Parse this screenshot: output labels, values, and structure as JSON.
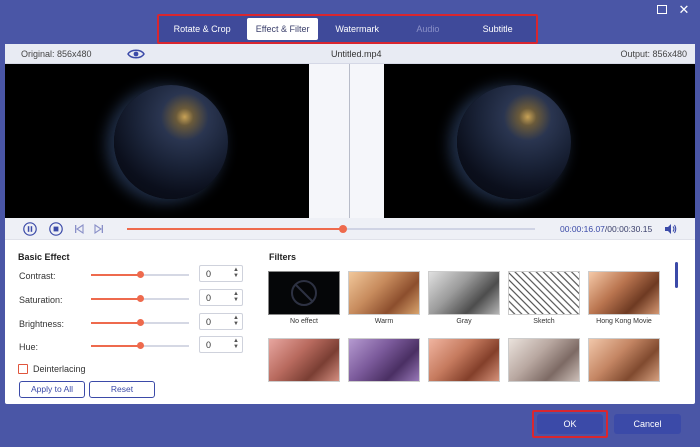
{
  "window": {
    "maximize_icon": "maximize-icon",
    "close_icon": "close-icon"
  },
  "tabs": [
    {
      "label": "Rotate & Crop",
      "state": "normal"
    },
    {
      "label": "Effect & Filter",
      "state": "active"
    },
    {
      "label": "Watermark",
      "state": "normal"
    },
    {
      "label": "Audio",
      "state": "disabled"
    },
    {
      "label": "Subtitle",
      "state": "normal"
    }
  ],
  "info": {
    "original": "Original: 856x480",
    "filename": "Untitled.mp4",
    "output": "Output: 856x480"
  },
  "player": {
    "current_time": "00:00:16.07",
    "separator": "/",
    "total_time": "00:00:30.15",
    "progress_fraction": 0.53
  },
  "basic_effect": {
    "title": "Basic Effect",
    "adjustments": [
      {
        "label": "Contrast:",
        "value": "0",
        "level": 0.5
      },
      {
        "label": "Saturation:",
        "value": "0",
        "level": 0.5
      },
      {
        "label": "Brightness:",
        "value": "0",
        "level": 0.5
      },
      {
        "label": "Hue:",
        "value": "0",
        "level": 0.5
      }
    ],
    "deinterlacing_label": "Deinterlacing",
    "deinterlacing_checked": false,
    "apply_all_label": "Apply to All",
    "reset_label": "Reset"
  },
  "filters": {
    "title": "Filters",
    "items": [
      {
        "name": "No effect",
        "style": "noeffect"
      },
      {
        "name": "Warm",
        "style": "t-warm"
      },
      {
        "name": "Gray",
        "style": "t-gray"
      },
      {
        "name": "Sketch",
        "style": "t-sketch"
      },
      {
        "name": "Hong Kong Movie",
        "style": "t-hk"
      },
      {
        "name": "",
        "style": "t-r2a"
      },
      {
        "name": "",
        "style": "t-r2b"
      },
      {
        "name": "",
        "style": "t-r2c"
      },
      {
        "name": "",
        "style": "t-r2d"
      },
      {
        "name": "",
        "style": "t-r2e"
      }
    ]
  },
  "footer": {
    "ok_label": "OK",
    "cancel_label": "Cancel"
  },
  "colors": {
    "accent": "#3b4aa8",
    "slider": "#ee6a4d",
    "highlight": "#d9262f",
    "frame": "#4a56a6"
  }
}
